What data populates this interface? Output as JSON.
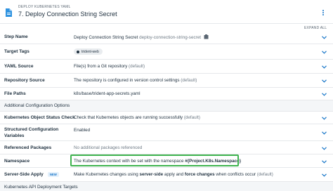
{
  "header": {
    "subtitle": "DEPLOY KUBERNETES YAML",
    "title": "7. Deploy Connection String Secret"
  },
  "expand_all": "EXPAND ALL",
  "rows": {
    "step_name": {
      "label": "Step Name",
      "value": "Deploy Connection String Secret",
      "muted": "deploy-connection-string-secret"
    },
    "target_tags": {
      "label": "Target Tags",
      "tag": "trident-web"
    },
    "yaml_source": {
      "label": "YAML Source",
      "value": "File(s) from a Git repository",
      "muted": "(default)"
    },
    "repository_source": {
      "label": "Repository Source",
      "value": "The repository is configured in version control settings",
      "muted": "(default)"
    },
    "file_paths": {
      "label": "File Paths",
      "value": "k8s/base/trident-app-secrets.yaml"
    },
    "additional_config": {
      "label": "Additional Configuration Options"
    },
    "status_check": {
      "label": "Kubernetes Object Status Check",
      "value": "Check that Kubernetes objects are running successfully",
      "muted": "(default)"
    },
    "structured_config": {
      "label_line1": "Structured Configuration",
      "label_line2": "Variables",
      "value": "Enabled"
    },
    "referenced_packages": {
      "label": "Referenced Packages",
      "value": "No additional packages referenced"
    },
    "namespace": {
      "label": "Namespace",
      "value_prefix": "The Kubernetes context with be set with the namespace ",
      "value_bold": "#{Project.K8s.Namespace}"
    },
    "server_side_apply": {
      "label": "Server-Side Apply",
      "badge": "NEW",
      "v1": "Make Kubernetes changes using ",
      "v2": "server-side",
      "v3": " apply and ",
      "v4": "force changes",
      "v5": " when conflicts occur",
      "muted": "(default)"
    },
    "api_targets": {
      "label": "Kubernetes API Deployment Targets"
    }
  },
  "colors": {
    "accent": "#1a77c9",
    "highlight": "#3fb34f",
    "section_bg": "#f4f6f8"
  },
  "icons": {
    "step": "kubernetes-yaml-icon",
    "menu": "vertical-dots-icon",
    "chevron": "chevron-down-icon",
    "copy": "clipboard-icon",
    "tag": "tag-dot-icon"
  }
}
